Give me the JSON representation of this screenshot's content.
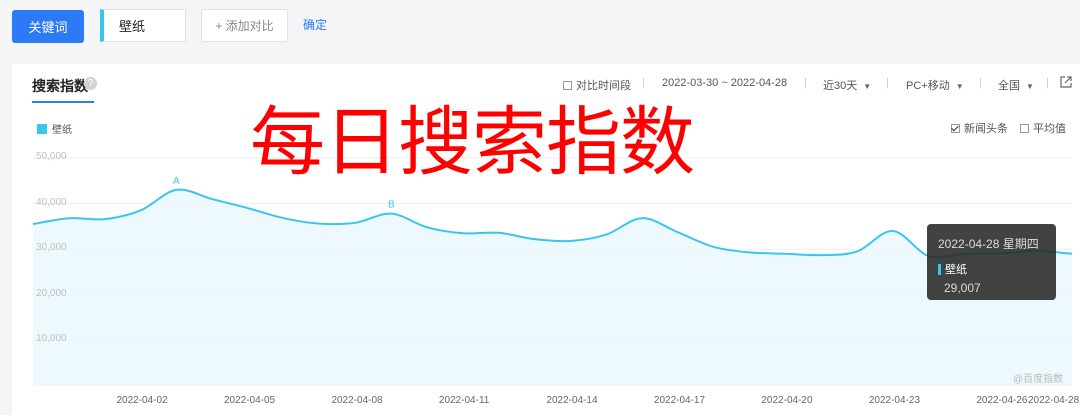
{
  "topbar": {
    "keyword_button": "关键词",
    "keyword": "壁纸",
    "add_compare": "+ 添加对比",
    "confirm": "确定"
  },
  "panel": {
    "title": "搜索指数",
    "help": "?",
    "compare_period": "对比时间段",
    "date_range": "2022-03-30 ~ 2022-04-28",
    "range_select": "近30天",
    "device_select": "PC+移动",
    "region_select": "全国",
    "legend_series": "壁纸",
    "news_toggle": "新闻头条",
    "average_toggle": "平均值",
    "watermark": "@百度指数"
  },
  "overlay_text": "每日搜索指数",
  "tooltip": {
    "date": "2022-04-28 星期四",
    "series": "壁纸",
    "value": "29,007"
  },
  "colors": {
    "accent": "#2c7af5",
    "series": "#39c6ee",
    "overlay": "#ff0000"
  },
  "chart_data": {
    "type": "area",
    "y_ticks": [
      "50,000",
      "40,000",
      "30,000",
      "20,000",
      "10,000"
    ],
    "ylim": [
      0,
      50000
    ],
    "x_tick_labels": [
      "2022-04-02",
      "2022-04-05",
      "2022-04-08",
      "2022-04-11",
      "2022-04-14",
      "2022-04-17",
      "2022-04-20",
      "2022-04-23",
      "2022-04-26",
      "2022-04-28"
    ],
    "x": [
      "2022-03-30",
      "2022-03-31",
      "2022-04-01",
      "2022-04-02",
      "2022-04-03",
      "2022-04-04",
      "2022-04-05",
      "2022-04-06",
      "2022-04-07",
      "2022-04-08",
      "2022-04-09",
      "2022-04-10",
      "2022-04-11",
      "2022-04-12",
      "2022-04-13",
      "2022-04-14",
      "2022-04-15",
      "2022-04-16",
      "2022-04-17",
      "2022-04-18",
      "2022-04-19",
      "2022-04-20",
      "2022-04-21",
      "2022-04-22",
      "2022-04-23",
      "2022-04-24",
      "2022-04-25",
      "2022-04-26",
      "2022-04-27",
      "2022-04-28"
    ],
    "series": [
      {
        "name": "壁纸",
        "values": [
          35500,
          36800,
          36600,
          38500,
          43000,
          41000,
          39000,
          36800,
          35600,
          35800,
          37800,
          34800,
          33500,
          33600,
          32200,
          31800,
          33200,
          36800,
          33700,
          30500,
          29300,
          29000,
          28700,
          29500,
          34000,
          28500,
          29000,
          29100,
          29600,
          29007
        ]
      }
    ],
    "annotations": [
      {
        "label": "A",
        "x": "2022-04-03"
      },
      {
        "label": "B",
        "x": "2022-04-09"
      }
    ],
    "grid": true
  }
}
